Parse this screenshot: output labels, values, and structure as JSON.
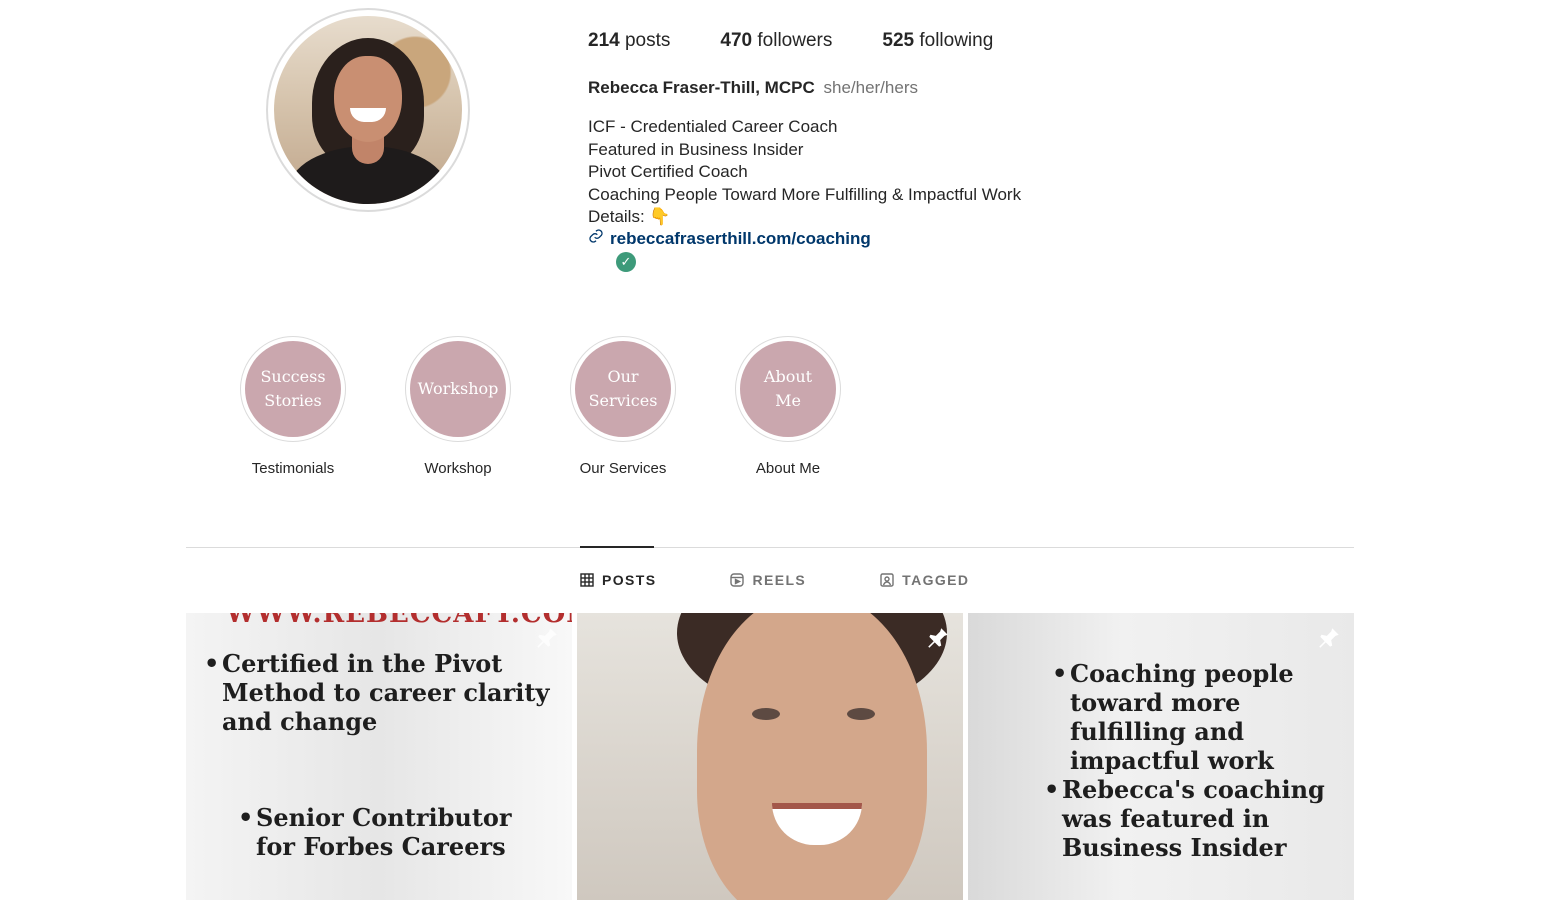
{
  "stats": {
    "posts": "214",
    "posts_label": "posts",
    "followers": "470",
    "followers_label": "followers",
    "following": "525",
    "following_label": "following"
  },
  "profile": {
    "name": "Rebecca Fraser-Thill, MCPC",
    "pronouns": "she/her/hers",
    "bio": [
      "ICF - Credentialed Career Coach",
      "Featured in Business Insider",
      "Pivot Certified Coach",
      "Coaching People Toward More Fulfilling & Impactful Work",
      "Details: 👇"
    ],
    "link": "rebeccafraserthill.com/coaching"
  },
  "highlights": [
    {
      "cover": "Success Stories",
      "label": "Testimonials"
    },
    {
      "cover": "Workshop",
      "label": "Workshop"
    },
    {
      "cover": "Our Services",
      "label": "Our Services"
    },
    {
      "cover": "About Me",
      "label": "About Me"
    }
  ],
  "tabs": [
    {
      "label": "POSTS",
      "icon": "grid-icon"
    },
    {
      "label": "REELS",
      "icon": "reels-icon"
    },
    {
      "label": "TAGGED",
      "icon": "tagged-icon"
    }
  ],
  "posts": [
    {
      "banner": "WWW.REBECCAFT.COM",
      "lines": [
        "Certified in the Pivot Method to career clarity and change",
        "Senior Contributor for Forbes Careers"
      ]
    },
    {
      "lines": []
    },
    {
      "lines": [
        "Coaching people toward more fulfilling and impactful work",
        "Rebecca's coaching was featured in Business Insider"
      ]
    }
  ],
  "colors": {
    "link": "#00376b",
    "highlight": "#caa7ae",
    "verified": "#3d9a7a"
  }
}
